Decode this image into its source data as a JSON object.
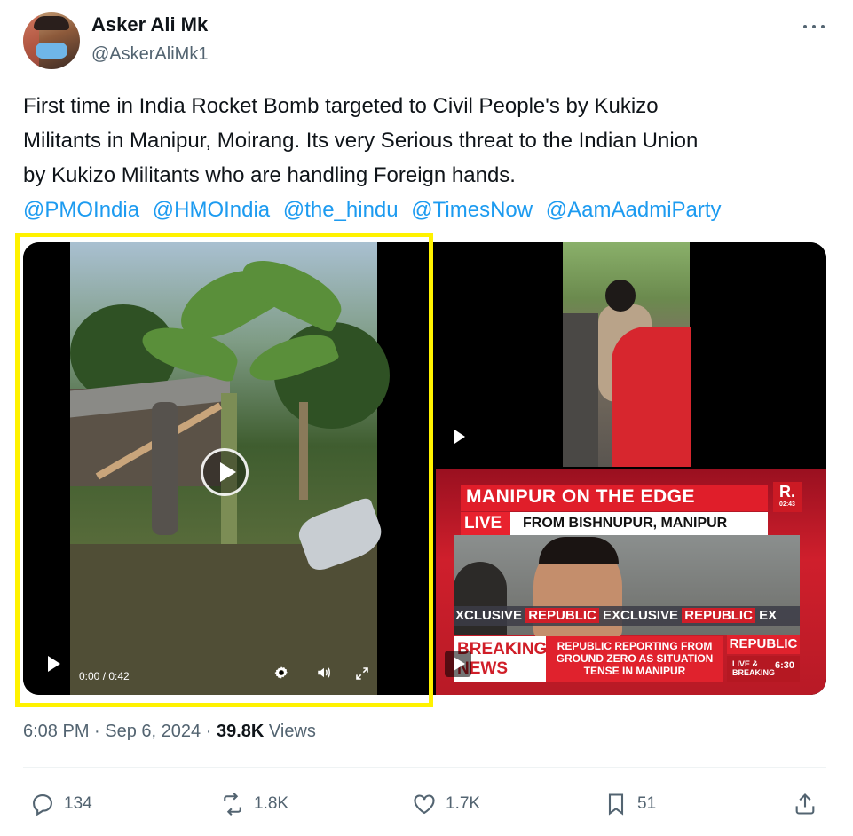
{
  "author": {
    "display_name": "Asker Ali Mk",
    "handle": "@AskerAliMk1"
  },
  "tweet": {
    "text_line1": "First time in India Rocket Bomb targeted to Civil People's by Kukizo",
    "text_line2": "Militants in Manipur, Moirang. Its very Serious threat to the Indian Union",
    "text_line3": "by Kukizo Militants who are handling Foreign hands.",
    "mentions": [
      "@PMOIndia",
      "@HMOIndia",
      "@the_hindu",
      "@TimesNow",
      "@AamAadmiParty"
    ]
  },
  "media": {
    "main_video": {
      "time": "0:00 / 0:42"
    },
    "news_video": {
      "headline": "MANIPUR ON THE EDGE",
      "logo": "R.",
      "live": "LIVE",
      "location": "FROM BISHNUPUR, MANIPUR",
      "exclusive_text": "XCLUSIVE",
      "republic_text": "REPUBLIC",
      "exclusive_text2": "EXCLUSIVE",
      "republic_text2": "REPUBLIC",
      "exc_tail": "EX",
      "breaking_line1": "BREAKING",
      "breaking_line2": "NEWS",
      "ticker": "REPUBLIC REPORTING FROM GROUND ZERO AS SITUATION TENSE IN MANIPUR",
      "republic_badge": "REPUBLIC",
      "live_breaking": "LIVE & BREAKING",
      "clock": "6:30"
    }
  },
  "meta": {
    "time": "6:08 PM",
    "separator": "·",
    "date": "Sep 6, 2024",
    "separator2": "·",
    "views_count": "39.8K",
    "views_label": "Views"
  },
  "actions": {
    "replies": "134",
    "reposts": "1.8K",
    "likes": "1.7K",
    "bookmarks": "51"
  },
  "colors": {
    "link": "#1d9bf0",
    "highlight": "#fff200",
    "muted": "#536471"
  }
}
